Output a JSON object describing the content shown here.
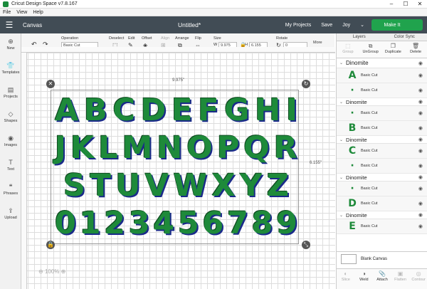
{
  "window": {
    "title": "Cricut Design Space  v7.8.167",
    "controls": [
      "–",
      "☐",
      "✕"
    ]
  },
  "menu": [
    "File",
    "View",
    "Help"
  ],
  "header": {
    "menu_icon": "menu-icon",
    "section": "Canvas",
    "project_title": "Untitled*",
    "my_projects": "My Projects",
    "save": "Save",
    "user": "Joy",
    "make_it": "Make It"
  },
  "toolbar": {
    "operation_label": "Operation",
    "operation_value": "Basic Cut",
    "deselect": "Deselect",
    "edit": "Edit",
    "offset": "Offset",
    "align": "Align",
    "arrange": "Arrange",
    "flip": "Flip",
    "size": "Size",
    "w_label": "W",
    "w_value": "9.975",
    "h_label": "H",
    "h_value": "6.155",
    "rotate": "Rotate",
    "rotate_value": "0",
    "more": "More"
  },
  "sidebar": [
    {
      "label": "New",
      "icon": "plus-icon"
    },
    {
      "label": "Templates",
      "icon": "shirt-icon"
    },
    {
      "label": "Projects",
      "icon": "projects-icon"
    },
    {
      "label": "Shapes",
      "icon": "shapes-icon"
    },
    {
      "label": "Images",
      "icon": "lightbulb-icon"
    },
    {
      "label": "Text",
      "icon": "text-icon"
    },
    {
      "label": "Phrases",
      "icon": "phrases-icon"
    },
    {
      "label": "Upload",
      "icon": "upload-icon"
    }
  ],
  "canvas": {
    "width_label": "9.975\"",
    "height_label": "6.155\"",
    "zoom": "100%",
    "rows": [
      [
        "A",
        "B",
        "C",
        "D",
        "E",
        "F",
        "G",
        "H",
        "I"
      ],
      [
        "J",
        "K",
        "L",
        "M",
        "N",
        "O",
        "P",
        "Q",
        "R"
      ],
      [
        "S",
        "T",
        "U",
        "V",
        "W",
        "X",
        "Y",
        "Z"
      ],
      [
        "0",
        "1",
        "2",
        "3",
        "4",
        "5",
        "6",
        "7",
        "8",
        "9"
      ]
    ]
  },
  "layers": {
    "tabs": [
      "Layers",
      "Color Sync"
    ],
    "tools": [
      "Group",
      "UnGroup",
      "Duplicate",
      "Delete"
    ],
    "groups": [
      {
        "name": "Dinomite",
        "items": [
          {
            "thumb": "A",
            "label": "Basic Cut"
          },
          {
            "thumb": "·",
            "label": "Basic Cut"
          }
        ]
      },
      {
        "name": "Dinomite",
        "items": [
          {
            "thumb": "·",
            "label": "Basic Cut"
          },
          {
            "thumb": "B",
            "label": "Basic Cut"
          }
        ]
      },
      {
        "name": "Dinomite",
        "items": [
          {
            "thumb": "C",
            "label": "Basic Cut"
          },
          {
            "thumb": "·",
            "label": "Basic Cut"
          }
        ]
      },
      {
        "name": "Dinomite",
        "items": [
          {
            "thumb": "·",
            "label": "Basic Cut"
          },
          {
            "thumb": "D",
            "label": "Basic Cut"
          }
        ]
      },
      {
        "name": "Dinomite",
        "items": [
          {
            "thumb": "E",
            "label": "Basic Cut"
          }
        ]
      }
    ],
    "blank_canvas": "Blank Canvas",
    "bottom_tools": [
      "Slice",
      "Weld",
      "Attach",
      "Flatten",
      "Contour"
    ]
  }
}
